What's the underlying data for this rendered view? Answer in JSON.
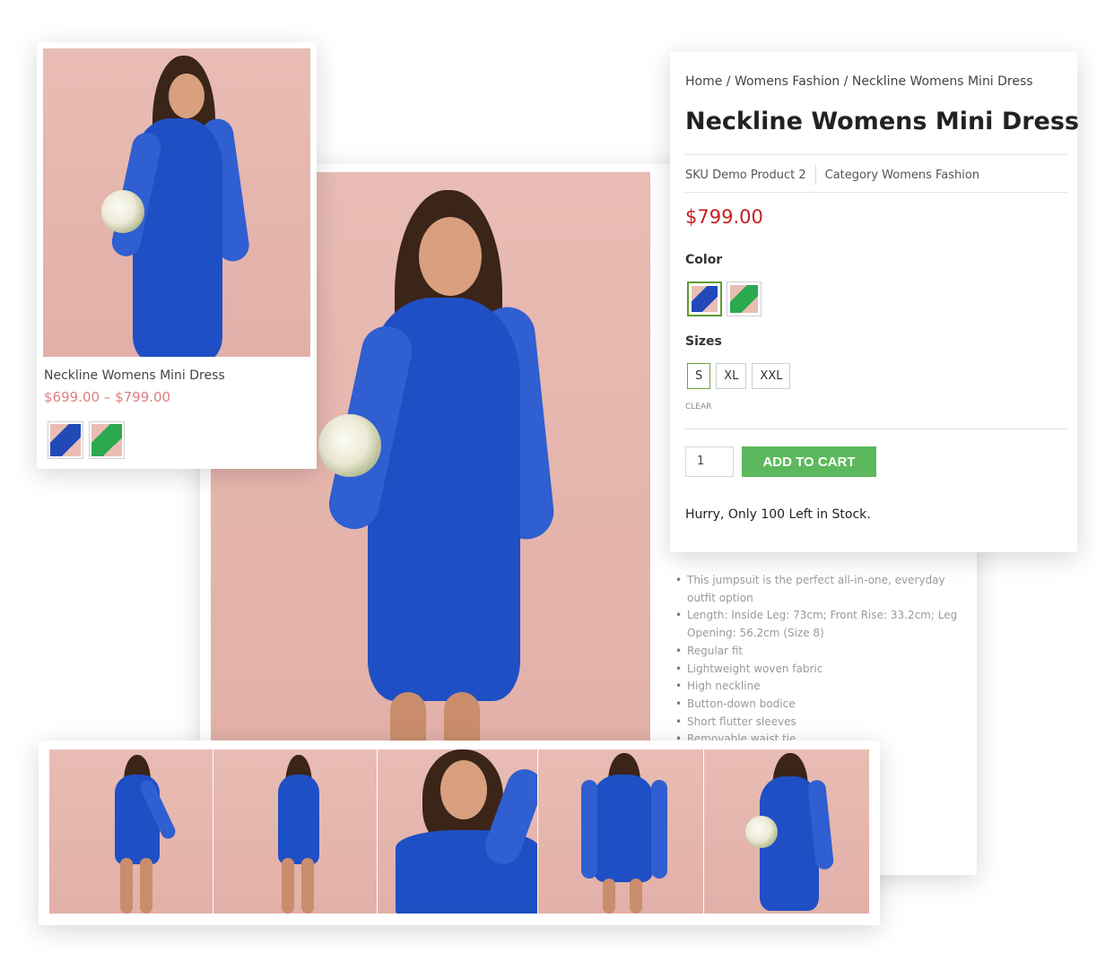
{
  "breadcrumb": {
    "home": "Home",
    "sep1": " / ",
    "category": "Womens Fashion",
    "sep2": " / ",
    "current": "Neckline Womens Mini Dress"
  },
  "product": {
    "title": "Neckline Womens Mini Dress",
    "sku_label": "SKU",
    "sku_value": "Demo Product 2",
    "category_label": "Category",
    "category_value": "Womens Fashion",
    "price": "$799.00",
    "color_label": "Color",
    "colors": [
      "blue",
      "green"
    ],
    "sizes_label": "Sizes",
    "sizes": [
      "S",
      "XL",
      "XXL"
    ],
    "selected_size": "S",
    "clear_label": "CLEAR",
    "quantity": "1",
    "add_to_cart": "ADD TO CART",
    "stock_note": "Hurry, Only 100 Left in Stock."
  },
  "listing_card": {
    "name": "Neckline Womens Mini Dress",
    "price_range": "$699.00 – $799.00"
  },
  "description": [
    "This jumpsuit is the perfect all-in-one, everyday outfit option",
    "Length: Inside Leg: 73cm; Front Rise: 33.2cm; Leg Opening: 56.2cm (Size 8)",
    "Regular fit",
    "Lightweight woven fabric",
    "High neckline",
    "Button-down bodice",
    "Short flutter sleeves",
    "Removable waist tie"
  ],
  "colors": {
    "price_red": "#c81e1e",
    "listing_price": "#e07e7e",
    "cart_green": "#5cb85c",
    "dress_blue": "#1f4fc4",
    "backdrop_pink": "#e8bcb4"
  }
}
